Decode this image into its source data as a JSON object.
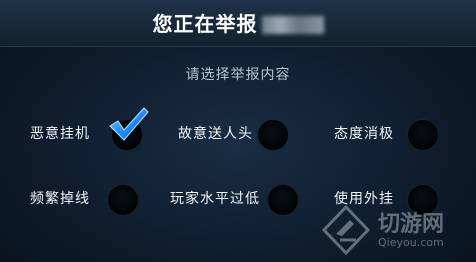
{
  "dialog": {
    "title": "您正在举报",
    "subtitle": "请选择举报内容"
  },
  "options": [
    {
      "label": "恶意挂机",
      "selected": true
    },
    {
      "label": "故意送人头",
      "selected": false
    },
    {
      "label": "态度消极",
      "selected": false
    },
    {
      "label": "频繁掉线",
      "selected": false
    },
    {
      "label": "玩家水平过低",
      "selected": false
    },
    {
      "label": "使用外挂",
      "selected": false
    }
  ],
  "watermark": {
    "text": "切游网",
    "url": "Qieyou.com"
  },
  "colors": {
    "check": "#1e8fff",
    "background": "#0f1d2e"
  }
}
